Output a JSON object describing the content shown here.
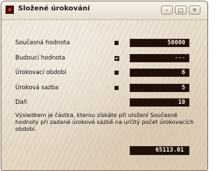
{
  "window": {
    "title": "Složené úrokování",
    "controls": {
      "minimize": "–",
      "maximize": "□",
      "close": "✕"
    }
  },
  "fields": [
    {
      "label": "Současná hodnota",
      "value": "50000",
      "marker": "square-icon"
    },
    {
      "label": "Budoucí hodnota",
      "value": "---",
      "marker": "checkbox-icon"
    },
    {
      "label": "Úrokovací období",
      "value": "6",
      "marker": "square-icon"
    },
    {
      "label": "Úroková sazba",
      "value": "5",
      "marker": "square-icon"
    },
    {
      "label": "Daň",
      "value": "10",
      "marker": "none"
    }
  ],
  "description": "Výsledkem je částka, kterou získáte při uložení Současné hodnoty při zadané úrokové sazbě na určitý počet úrokovacích období.",
  "result": "65113.01",
  "colors": {
    "field_bg": "#1e0f08",
    "field_text": "#f6efe6",
    "window_bg": "#e8dccb"
  }
}
